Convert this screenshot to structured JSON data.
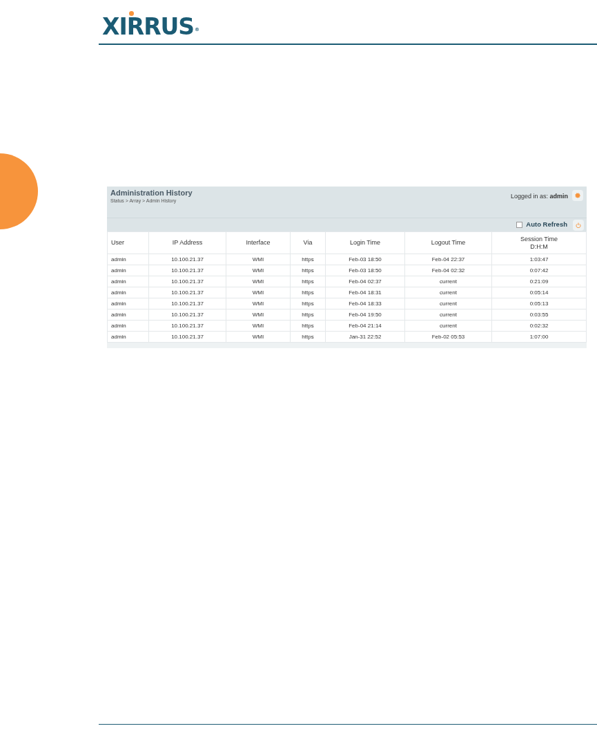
{
  "logo": {
    "text": "XIRRUS",
    "mark": "®"
  },
  "panel": {
    "title": "Administration History",
    "breadcrumb": "Status > Array > Admin History",
    "logged_in_label": "Logged in as:",
    "logged_in_user": "admin",
    "auto_refresh": {
      "label": "Auto Refresh",
      "checked": false
    }
  },
  "table": {
    "columns": [
      "User",
      "IP Address",
      "Interface",
      "Via",
      "Login Time",
      "Logout Time",
      "Session Time\nD:H:M"
    ],
    "rows": [
      [
        "admin",
        "10.100.21.37",
        "WMI",
        "https",
        "Feb-03 18:50",
        "Feb-04 22:37",
        "1:03:47"
      ],
      [
        "admin",
        "10.100.21.37",
        "WMI",
        "https",
        "Feb-03 18:50",
        "Feb-04 02:32",
        "0:07:42"
      ],
      [
        "admin",
        "10.100.21.37",
        "WMI",
        "https",
        "Feb-04 02:37",
        "current",
        "0:21:09"
      ],
      [
        "admin",
        "10.100.21.37",
        "WMI",
        "https",
        "Feb-04 18:31",
        "current",
        "0:05:14"
      ],
      [
        "admin",
        "10.100.21.37",
        "WMI",
        "https",
        "Feb-04 18:33",
        "current",
        "0:05:13"
      ],
      [
        "admin",
        "10.100.21.37",
        "WMI",
        "https",
        "Feb-04 19:50",
        "current",
        "0:03:55"
      ],
      [
        "admin",
        "10.100.21.37",
        "WMI",
        "https",
        "Feb-04 21:14",
        "current",
        "0:02:32"
      ],
      [
        "admin",
        "10.100.21.37",
        "WMI",
        "https",
        "Jan-31 22:52",
        "Feb-02 05:53",
        "1:07:00"
      ]
    ]
  }
}
